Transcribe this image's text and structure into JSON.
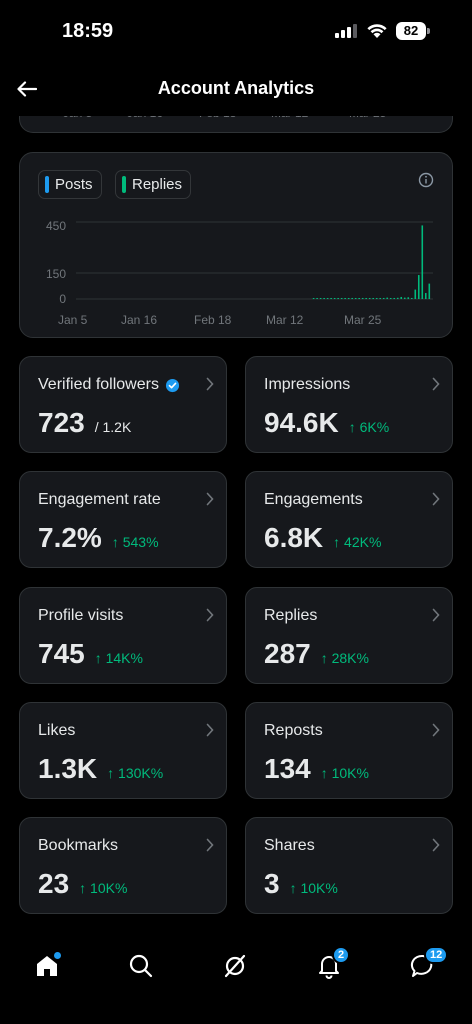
{
  "status_bar": {
    "time": "18:59",
    "battery": "82"
  },
  "header": {
    "title": "Account Analytics"
  },
  "previous_chart_labels": [
    "Jan 5",
    "Jan 16",
    "Feb 18",
    "Mar 12",
    "Mar 25"
  ],
  "chart_data": {
    "type": "bar",
    "legend": [
      "Posts",
      "Replies"
    ],
    "colors": {
      "posts": "#1d9bf0",
      "replies": "#00ba7c"
    },
    "x_tick_labels": [
      "Jan 5",
      "Jan 16",
      "Feb 18",
      "Mar 12",
      "Mar 25"
    ],
    "y_tick_labels": [
      "450",
      "150",
      "0"
    ],
    "ylim": [
      0,
      450
    ],
    "grid": true,
    "series": [
      {
        "name": "Replies",
        "values": [
          0,
          0,
          0,
          0,
          0,
          0,
          0,
          0,
          0,
          0,
          0,
          0,
          0,
          0,
          0,
          0,
          0,
          0,
          0,
          0,
          0,
          0,
          0,
          0,
          0,
          0,
          0,
          0,
          0,
          0,
          0,
          0,
          0,
          0,
          0,
          0,
          0,
          0,
          0,
          0,
          0,
          0,
          0,
          0,
          0,
          0,
          0,
          0,
          0,
          0,
          0,
          0,
          0,
          0,
          0,
          0,
          0,
          0,
          0,
          0,
          0,
          0,
          0,
          0,
          0,
          0,
          0,
          1,
          2,
          2,
          3,
          2,
          2,
          3,
          2,
          2,
          3,
          4,
          6,
          3,
          4,
          6,
          3,
          3,
          5,
          5,
          4,
          6,
          8,
          4,
          6,
          7,
          12,
          8,
          10,
          6,
          55,
          140,
          430,
          35,
          90
        ]
      }
    ]
  },
  "stats": [
    {
      "label": "Verified followers",
      "value": "723",
      "total": "/ 1.2K",
      "verified": true
    },
    {
      "label": "Impressions",
      "value": "94.6K",
      "change": "↑ 6K%"
    },
    {
      "label": "Engagement rate",
      "value": "7.2%",
      "change": "↑ 543%"
    },
    {
      "label": "Engagements",
      "value": "6.8K",
      "change": "↑ 42K%"
    },
    {
      "label": "Profile visits",
      "value": "745",
      "change": "↑ 14K%"
    },
    {
      "label": "Replies",
      "value": "287",
      "change": "↑ 28K%"
    },
    {
      "label": "Likes",
      "value": "1.3K",
      "change": "↑ 130K%"
    },
    {
      "label": "Reposts",
      "value": "134",
      "change": "↑ 10K%"
    },
    {
      "label": "Bookmarks",
      "value": "23",
      "change": "↑ 10K%"
    },
    {
      "label": "Shares",
      "value": "3",
      "change": "↑ 10K%"
    }
  ],
  "tab_bar": {
    "notifications_badge": "2",
    "messages_badge": "12",
    "icons": [
      "home-icon",
      "search-icon",
      "grok-icon",
      "bell-icon",
      "messages-icon"
    ]
  }
}
